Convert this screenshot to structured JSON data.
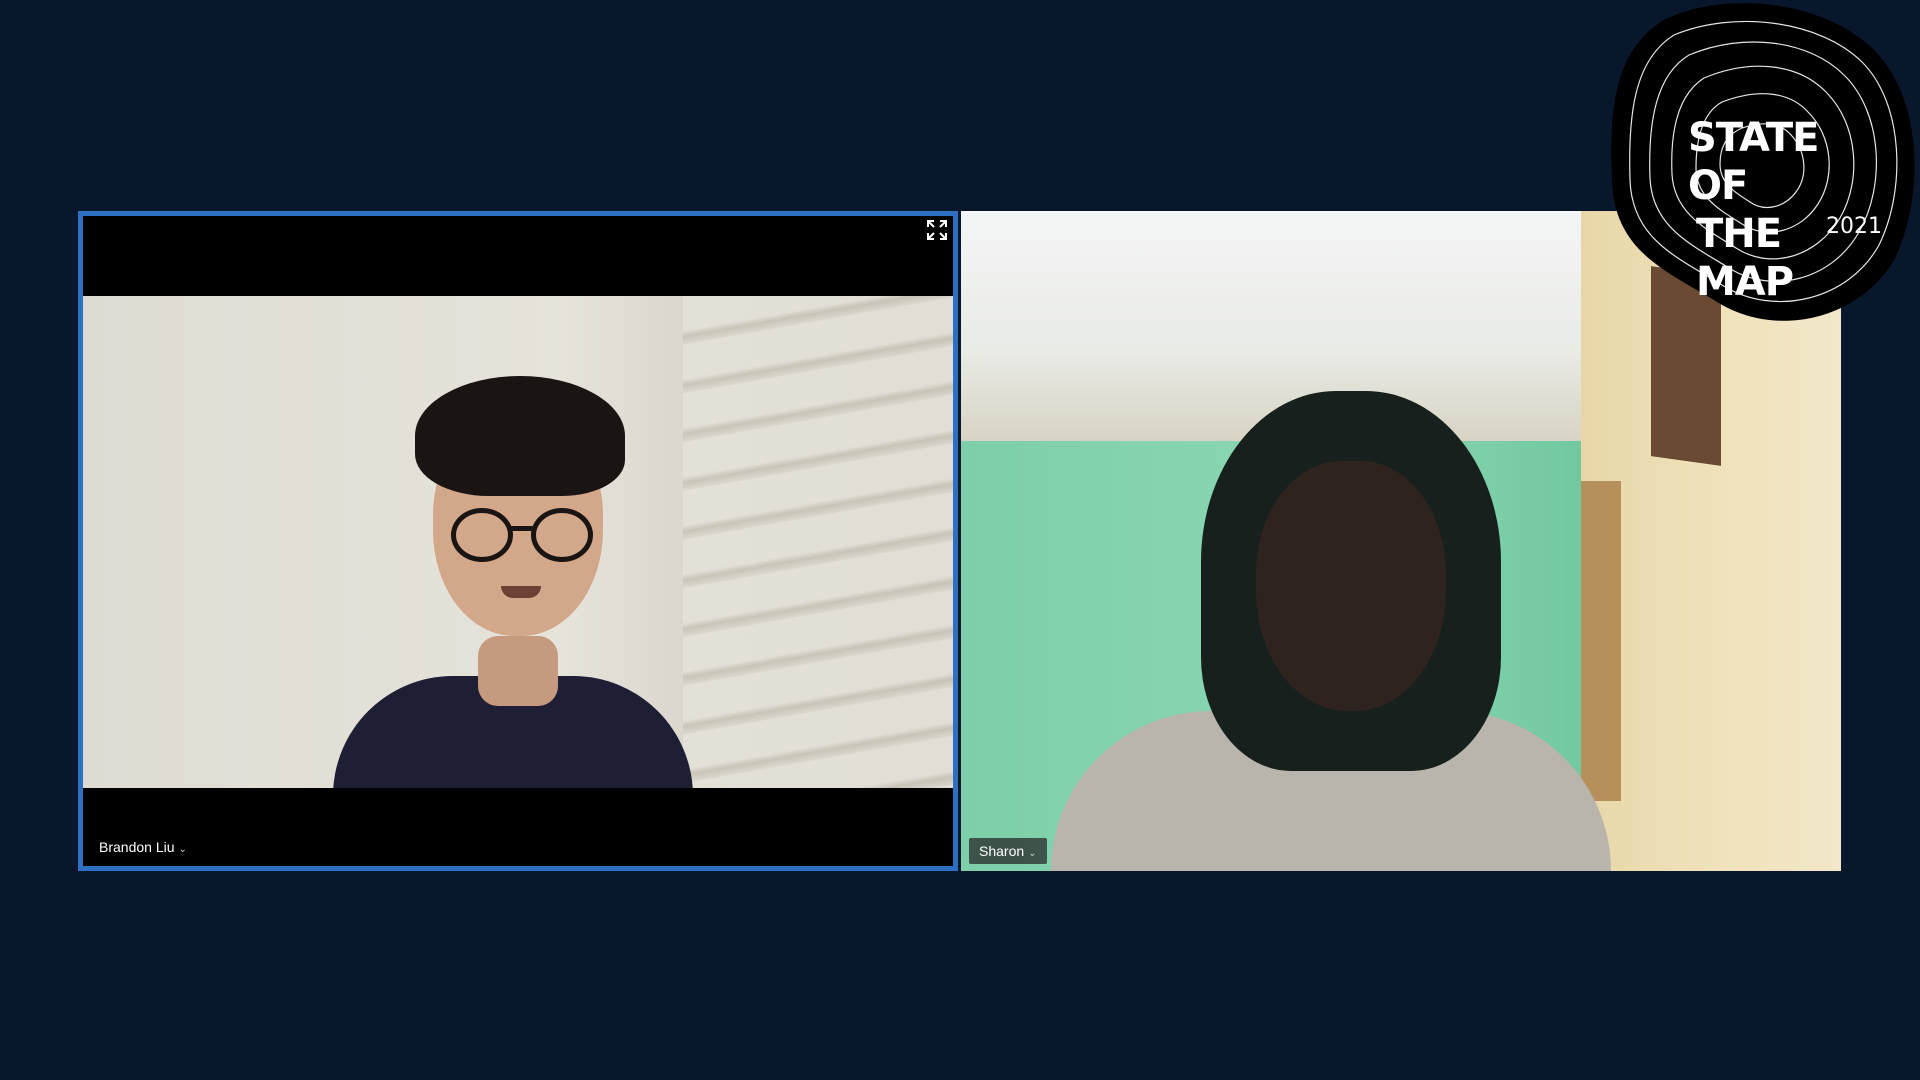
{
  "participants": [
    {
      "name": "Brandon Liu",
      "dropdown_glyph": "⌄",
      "active_speaker": true
    },
    {
      "name": "Sharon",
      "dropdown_glyph": "⌄",
      "active_speaker": false
    }
  ],
  "logo": {
    "line1": "STATE OF",
    "line2": "THE MAP",
    "year": "2021"
  },
  "colors": {
    "background": "#08172b",
    "active_speaker_border": "#2d6fc0"
  },
  "icons": {
    "fullscreen": "fullscreen-icon",
    "dropdown": "chevron-down-icon"
  }
}
